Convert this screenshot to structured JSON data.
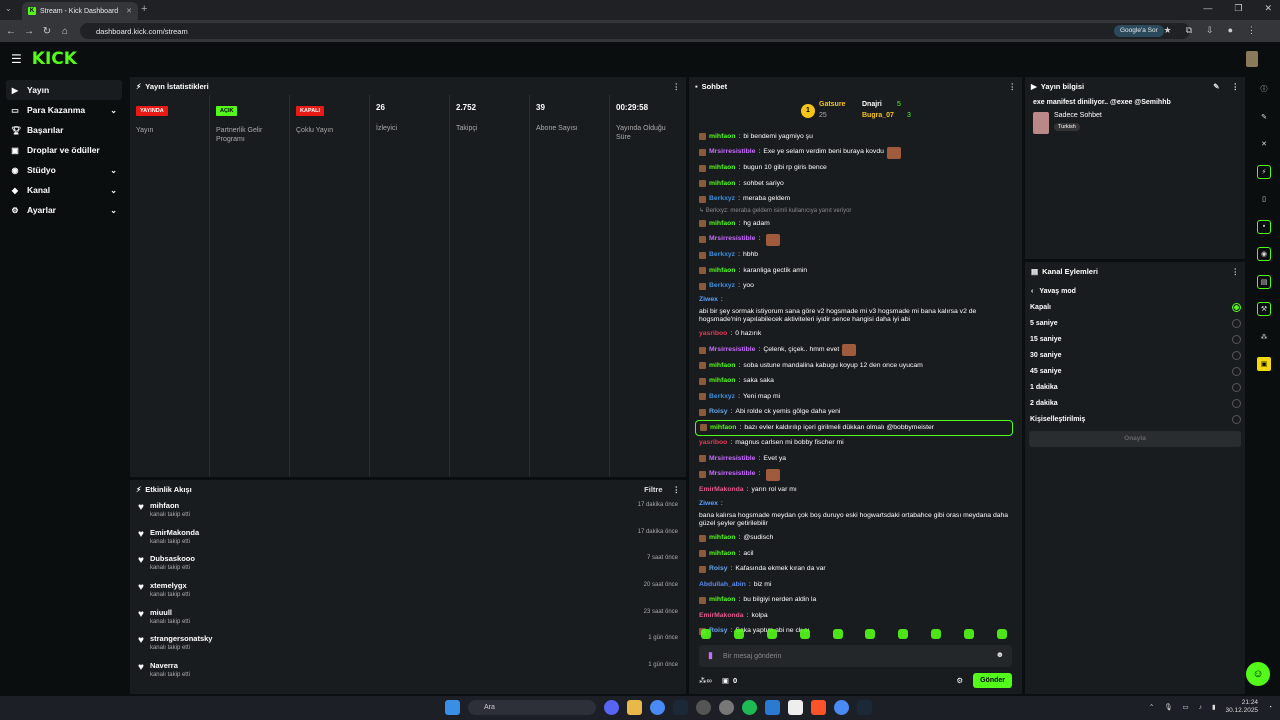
{
  "browser": {
    "tab_title": "Stream - Kick Dashboard",
    "url": "dashboard.kick.com/stream",
    "google_sor": "Google'a Sor"
  },
  "brand": {
    "logo": "KICK",
    "accent": "#53fc18"
  },
  "sidebar": {
    "items": [
      {
        "label": "Yayın",
        "icon": "video-icon",
        "active": true,
        "chev": false
      },
      {
        "label": "Para Kazanma",
        "icon": "money-icon",
        "chev": true
      },
      {
        "label": "Başarılar",
        "icon": "trophy-icon",
        "chev": false
      },
      {
        "label": "Droplar ve ödüller",
        "icon": "gift-icon",
        "chev": false
      },
      {
        "label": "Stüdyo",
        "icon": "studio-icon",
        "chev": true
      },
      {
        "label": "Kanal",
        "icon": "channel-icon",
        "chev": true
      },
      {
        "label": "Ayarlar",
        "icon": "settings-icon",
        "chev": true
      }
    ]
  },
  "stats": {
    "title": "Yayın İstatistikleri",
    "cols": [
      {
        "badge": "YAYINDA",
        "badge_type": "red",
        "label": "Yayın"
      },
      {
        "badge": "AÇIK",
        "badge_type": "green",
        "label": "Partnerlik Gelir Programı"
      },
      {
        "badge": "KAPALI",
        "badge_type": "red",
        "label": "Çoklu Yayın"
      },
      {
        "value": "26",
        "label": "İzleyici"
      },
      {
        "value": "2.752",
        "label": "Takipçi"
      },
      {
        "value": "39",
        "label": "Abone Sayısı"
      },
      {
        "value": "00:29:58",
        "label": "Yayında Olduğu Süre"
      }
    ]
  },
  "events": {
    "title": "Etkinlik Akışı",
    "filter": "Filtre",
    "items": [
      {
        "name": "mihfaon",
        "sub": "kanalı takip etti",
        "time": "17 dakika önce"
      },
      {
        "name": "EmirMakonda",
        "sub": "kanalı takip etti",
        "time": "17 dakika önce"
      },
      {
        "name": "Dubsaskooo",
        "sub": "kanalı takip etti",
        "time": "7 saat önce"
      },
      {
        "name": "xtemelygx",
        "sub": "kanalı takip etti",
        "time": "20 saat önce"
      },
      {
        "name": "miuull",
        "sub": "kanalı takip etti",
        "time": "23 saat önce"
      },
      {
        "name": "strangersonatsky",
        "sub": "kanalı takip etti",
        "time": "1 gün önce"
      },
      {
        "name": "Naverra",
        "sub": "kanalı takip etti",
        "time": "1 gün önce"
      }
    ]
  },
  "chat": {
    "title": "Sohbet",
    "pinned": {
      "rank": "1",
      "user1": "Gatsure",
      "user1_count": "25",
      "user2": "Dnajri",
      "user2_count": "5",
      "user3": "Bugra_07",
      "user3_count": "3"
    },
    "messages": [
      {
        "user": "mihfaon",
        "color": "#53fc18",
        "text": "bi bendemi yagmiyo şu",
        "badge": true
      },
      {
        "user": "Mrsirresistible",
        "color": "#c86bff",
        "text": "Exe ye selam verdim beni buraya kovdu",
        "badge": true,
        "emote": true
      },
      {
        "user": "mihfaon",
        "color": "#53fc18",
        "text": "bugun 10 gibi rp giris bence",
        "badge": true
      },
      {
        "user": "mihfaon",
        "color": "#53fc18",
        "text": "sohbet sariyo",
        "badge": true
      },
      {
        "user": "Berkxyz",
        "color": "#3b8fe0",
        "text": "meraba geldem",
        "badge": true
      },
      {
        "reply": "↳ Berkxyz: meraba geldem isimli kullanıcıya yanıt veriyor"
      },
      {
        "user": "mihfaon",
        "color": "#53fc18",
        "text": "hg adam",
        "badge": true
      },
      {
        "user": "Mrsirresistible",
        "color": "#c86bff",
        "text": "",
        "badge": true,
        "emote": true
      },
      {
        "user": "Berkxyz",
        "color": "#3b8fe0",
        "text": "hbhb",
        "badge": true
      },
      {
        "user": "mihfaon",
        "color": "#53fc18",
        "text": "karanliga gectik amin",
        "badge": true
      },
      {
        "user": "Berkxyz",
        "color": "#3b8fe0",
        "text": "yoo",
        "badge": true
      },
      {
        "user": "Ziwex",
        "color": "#5aa0ff",
        "text": "abi bir şey sormak istiyorum sana göre v2 hogsmade mi v3 hogsmade mi bana kalırsa v2 de hogsmade'nin yapılabilecek aktiviteleri iyidir sence hangisi daha iyi abi"
      },
      {
        "user": "yasriboo",
        "color": "#e23b5a",
        "text": "0 hazırık"
      },
      {
        "user": "Mrsirresistible",
        "color": "#c86bff",
        "text": "Çelenk, çiçek.. hmm evet",
        "badge": true,
        "emote": true
      },
      {
        "user": "mihfaon",
        "color": "#53fc18",
        "text": "soba ustune mandalina kabugu koyup 12 den once uyucam",
        "badge": true
      },
      {
        "user": "mihfaon",
        "color": "#53fc18",
        "text": "saka saka",
        "badge": true
      },
      {
        "user": "Berkxyz",
        "color": "#3b8fe0",
        "text": "Yeni map mi",
        "badge": true
      },
      {
        "user": "Roisy",
        "color": "#6aa4e8",
        "text": "Abi rolde ck yemis gölge daha yeni",
        "badge": true
      },
      {
        "user": "mihfaon",
        "color": "#53fc18",
        "text": "bazı evler kaldırılıp içeri girilmeli dükkan olmalı @bobbymeister",
        "badge": true,
        "highlight": true
      },
      {
        "user": "yasriboo",
        "color": "#e23b5a",
        "text": "magnus carlsen mi bobby fischer mi"
      },
      {
        "user": "Mrsirresistible",
        "color": "#c86bff",
        "text": "Evet ya",
        "badge": true
      },
      {
        "user": "Mrsirresistible",
        "color": "#c86bff",
        "text": "",
        "badge": true,
        "emote": true
      },
      {
        "user": "EmirMakonda",
        "color": "#e25a8a",
        "text": "yarın rol var mı"
      },
      {
        "user": "Ziwex",
        "color": "#5aa0ff",
        "text": "bana kalırsa hogsmade meydan çok boş duruyo eski hogwartsdaki ortabahce gibi orası meydana daha güzel şeyler getirilebilir"
      },
      {
        "user": "mihfaon",
        "color": "#53fc18",
        "text": "@sudisch",
        "badge": true
      },
      {
        "user": "mihfaon",
        "color": "#53fc18",
        "text": "acil",
        "badge": true
      },
      {
        "user": "Roisy",
        "color": "#6aa4e8",
        "text": "Kafasında ekmek kıran da var",
        "badge": true
      },
      {
        "user": "Abdullah_abin",
        "color": "#5a8ae8",
        "text": "biz mi"
      },
      {
        "user": "mihfaon",
        "color": "#53fc18",
        "text": "bu bilgiyi nerden aldin la",
        "badge": true
      },
      {
        "user": "EmirMakonda",
        "color": "#e25a8a",
        "text": "kolpa"
      },
      {
        "user": "Roisy",
        "color": "#6aa4e8",
        "text": "Şaka yaptım abi ne ck sı",
        "badge": true
      }
    ],
    "input_placeholder": "Bir mesaj gönderin",
    "points": "0",
    "send": "Gönder"
  },
  "info": {
    "title": "Yayın bilgisi",
    "stream_title": "exe manifest diniliyor.. @exee @Semihhb",
    "category": "Sadece Sohbet",
    "tag": "Turkish"
  },
  "actions": {
    "title": "Kanal Eylemleri",
    "back_label": "Yavaş mod",
    "options": [
      {
        "label": "Kapalı",
        "on": true
      },
      {
        "label": "5 saniye"
      },
      {
        "label": "15 saniye"
      },
      {
        "label": "30 saniye"
      },
      {
        "label": "45 saniye"
      },
      {
        "label": "1 dakika"
      },
      {
        "label": "2 dakika"
      },
      {
        "label": "Kişiselleştirilmiş"
      }
    ],
    "apply": "Onayla"
  },
  "taskbar": {
    "search": "Ara",
    "time": "21:24",
    "date": "30.12.2025"
  }
}
